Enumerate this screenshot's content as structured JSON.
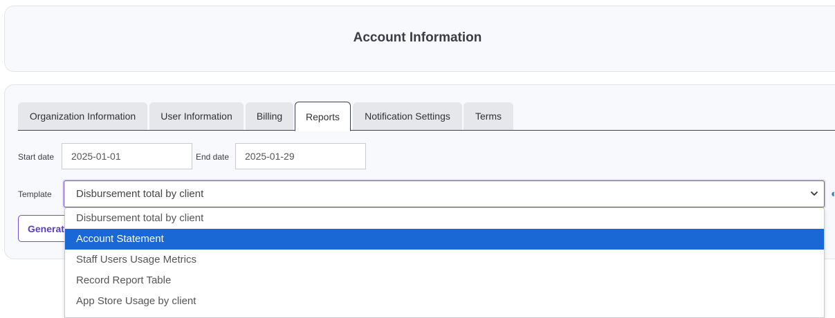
{
  "header": {
    "title": "Account Information"
  },
  "tabs": [
    {
      "label": "Organization Information",
      "active": false
    },
    {
      "label": "User Information",
      "active": false
    },
    {
      "label": "Billing",
      "active": false
    },
    {
      "label": "Reports",
      "active": true
    },
    {
      "label": "Notification Settings",
      "active": false
    },
    {
      "label": "Terms",
      "active": false
    }
  ],
  "form": {
    "start_date_label": "Start date",
    "start_date_value": "2025-01-01",
    "end_date_label": "End date",
    "end_date_value": "2025-01-29",
    "template_label": "Template",
    "template_value": "Disbursement total by client",
    "generate_label": "Generate"
  },
  "dropdown": {
    "options": [
      "Disbursement total by client",
      "Account Statement",
      "Staff Users Usage Metrics",
      "Record Report Table",
      "App Store Usage by client"
    ],
    "highlighted_index": 1
  },
  "colors": {
    "accent": "#6b4fcf",
    "highlight": "#1a67d6",
    "tab_line": "#3d3f4a"
  },
  "icons": {
    "select_chevron": "chevron-down-icon",
    "side_partial": "partial-icon"
  }
}
